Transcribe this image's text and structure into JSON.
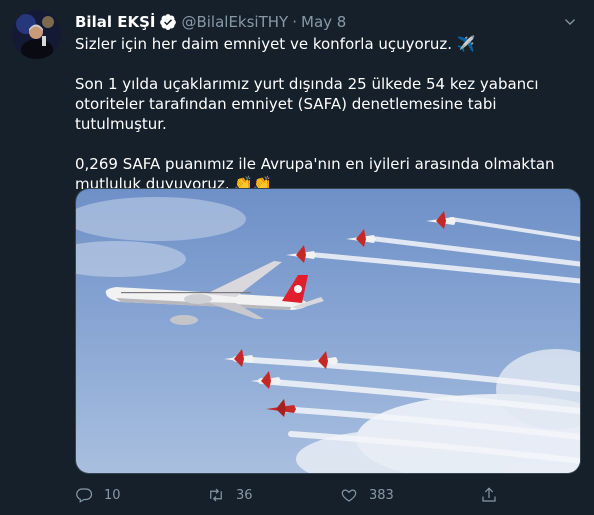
{
  "tweet": {
    "author_name": "Bilal EKŞİ",
    "handle": "@BilalEksiTHY",
    "separator": "·",
    "date": "May 8",
    "paragraphs": [
      "Sizler için her daim emniyet ve konforla uçuyoruz. ✈️",
      "Son 1 yılda uçaklarımız yurt dışında 25 ülkede 54 kez yabancı  otoriteler tarafından emniyet (SAFA) denetlemesine tabi tutulmuştur.",
      "0,269 SAFA puanımız ile Avrupa'nın en iyileri arasında olmaktan mutluluk duyuyoruz. 👏👏"
    ]
  },
  "actions": {
    "reply_count": "10",
    "retweet_count": "36",
    "like_count": "383"
  },
  "icons": {
    "verified": "verified-badge-icon",
    "caret": "chevron-down-icon",
    "reply": "reply-icon",
    "retweet": "retweet-icon",
    "like": "heart-icon",
    "share": "share-icon"
  },
  "colors": {
    "background": "#15202b",
    "secondary_text": "#8899a6",
    "verified": "#1da1f2"
  }
}
